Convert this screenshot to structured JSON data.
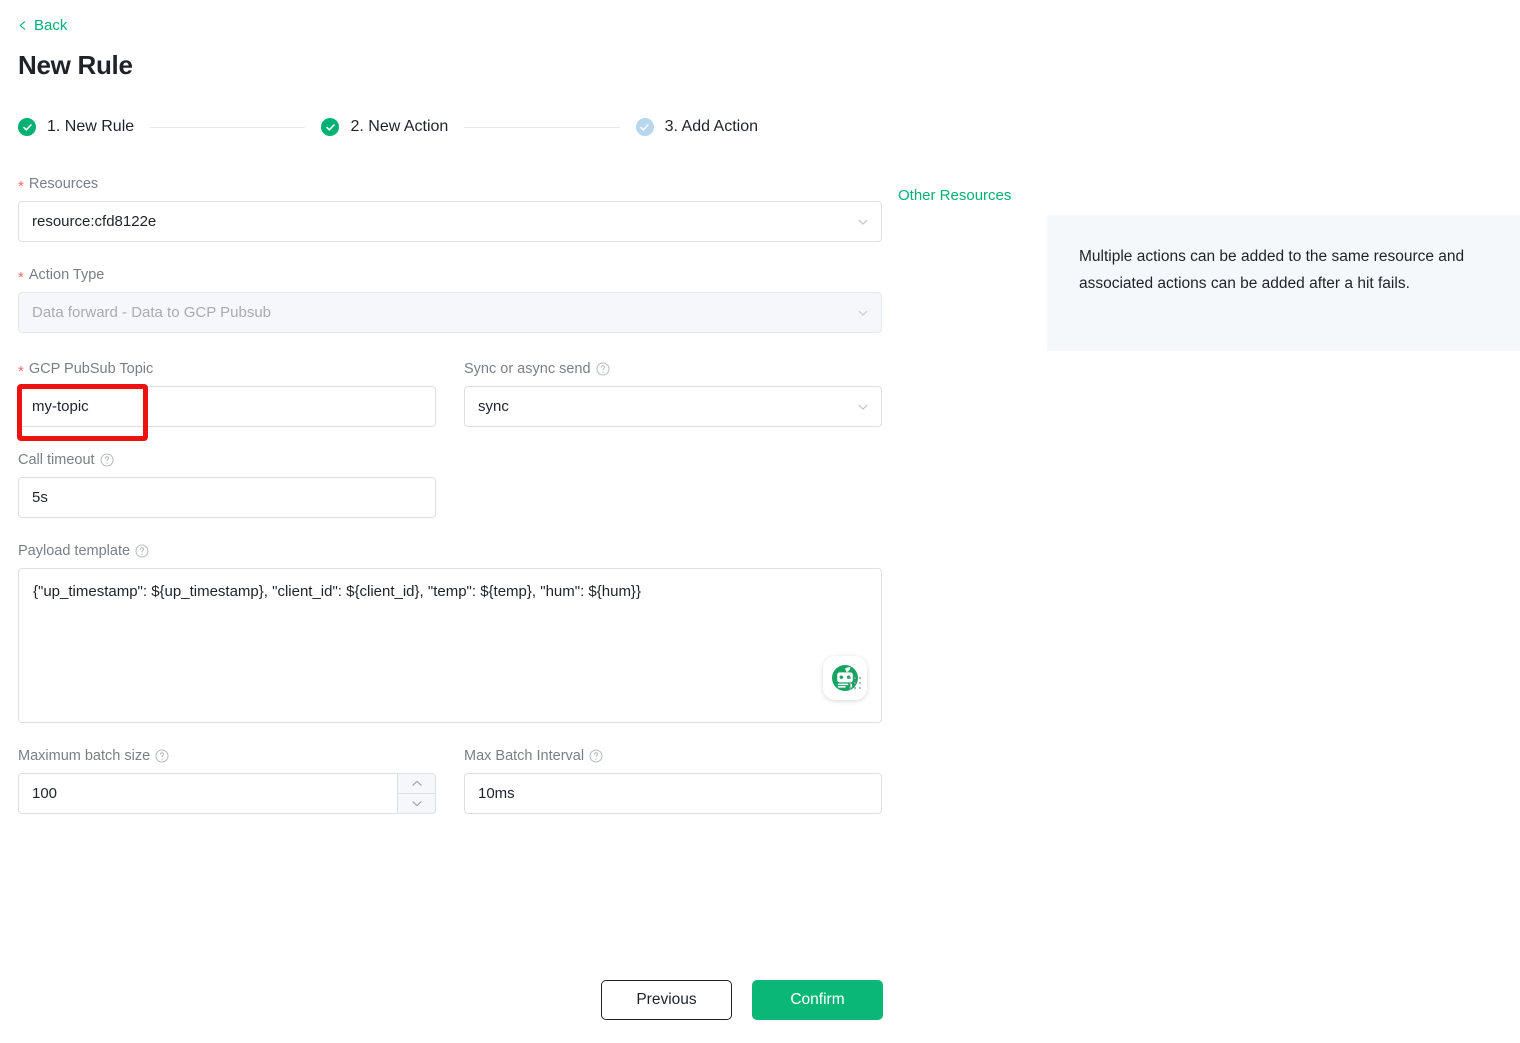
{
  "header": {
    "back_label": "Back",
    "back_icon": "chevron-left-icon",
    "title": "New Rule"
  },
  "steps": [
    {
      "label": "1. New Rule",
      "state": "done",
      "icon": "check-circle-icon"
    },
    {
      "label": "2. New Action",
      "state": "done",
      "icon": "check-circle-icon"
    },
    {
      "label": "3. Add Action",
      "state": "pending",
      "icon": "check-circle-icon"
    }
  ],
  "form": {
    "resources": {
      "label": "Resources",
      "required_marker": "*",
      "value": "resource:cfd8122e",
      "dropdown_icon": "chevron-down-icon",
      "other_resources_link": "Other Resources"
    },
    "action_type": {
      "label": "Action Type",
      "required_marker": "*",
      "value": "Data forward - Data to GCP Pubsub",
      "dropdown_icon": "chevron-down-icon"
    },
    "topic": {
      "label": "GCP PubSub Topic",
      "required_marker": "*",
      "value": "my-topic"
    },
    "sync": {
      "label": "Sync or async send",
      "help_icon": "question-circle-icon",
      "value": "sync",
      "dropdown_icon": "chevron-down-icon"
    },
    "call_timeout": {
      "label": "Call timeout",
      "help_icon": "question-circle-icon",
      "value": "5s"
    },
    "payload_template": {
      "label": "Payload template",
      "help_icon": "question-circle-icon",
      "value": "{\"up_timestamp\": ${up_timestamp}, \"client_id\": ${client_id}, \"temp\": ${temp}, \"hum\": ${hum}}",
      "assistant_icon": "robot-avatar-icon",
      "resize_icon": "resize-handle-icon"
    },
    "max_batch_size": {
      "label": "Maximum batch size",
      "help_icon": "question-circle-icon",
      "value": "100",
      "increment_icon": "chevron-up-icon",
      "decrement_icon": "chevron-down-icon"
    },
    "max_batch_interval": {
      "label": "Max Batch Interval",
      "help_icon": "question-circle-icon",
      "value": "10ms"
    }
  },
  "footer": {
    "previous_label": "Previous",
    "confirm_label": "Confirm"
  },
  "info_panel": {
    "text": "Multiple actions can be added to the same resource and associated actions can be added after a hit fails."
  },
  "colors": {
    "accent_green": "#00b173",
    "confirm_green": "#0ab777",
    "pending_blue": "#b6d7ee",
    "required_red": "#f56c6c",
    "annotation_red": "#ee1111",
    "info_bg": "#f4f8fa",
    "border": "#dcdfe6"
  },
  "annotation": {
    "type": "red-highlight-box",
    "target": "gcp-pubsub-topic-input"
  }
}
